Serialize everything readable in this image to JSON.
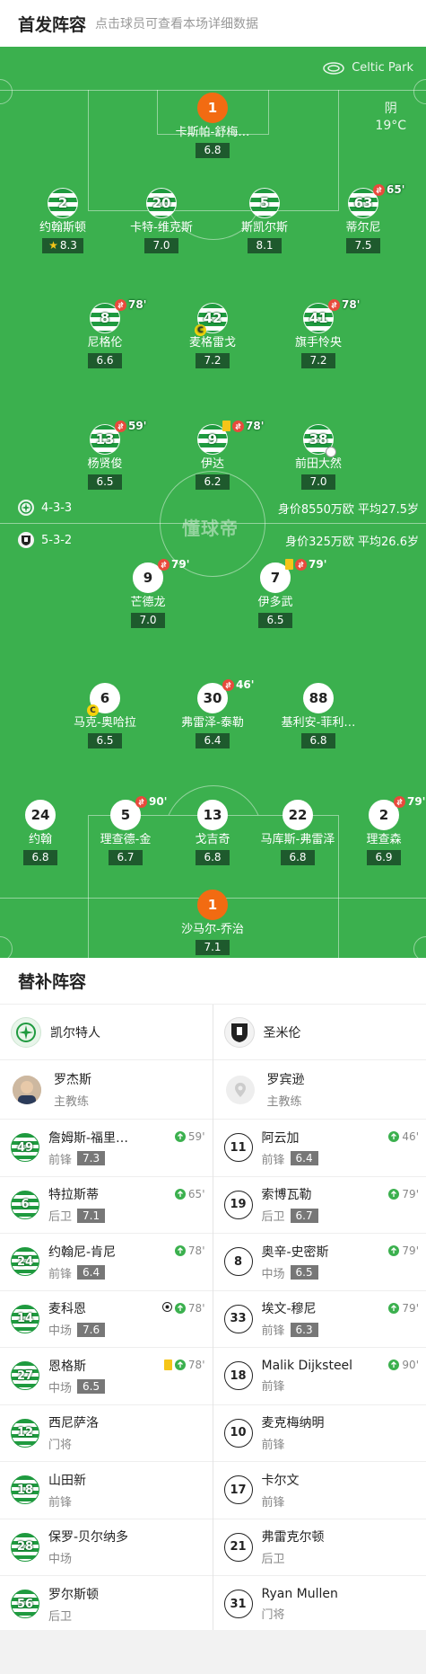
{
  "header": {
    "title": "首发阵容",
    "subtitle": "点击球员可查看本场详细数据"
  },
  "pitch": {
    "venue": "Celtic Park",
    "weather": {
      "condition": "阴",
      "temp": "19°C"
    },
    "watermark": "懂球帝",
    "home": {
      "formation": "4-3-3",
      "info": "身价8550万欧  平均27.5岁"
    },
    "away": {
      "formation": "5-3-2",
      "info": "身价325万欧  平均26.6岁"
    }
  },
  "players": [
    {
      "num": "1",
      "name": "卡斯帕-舒梅…",
      "rating": "6.8",
      "kit": "gk"
    },
    {
      "num": "2",
      "name": "约翰斯顿",
      "rating": "8.3",
      "kit": "hoop",
      "star": true
    },
    {
      "num": "20",
      "name": "卡特-维克斯",
      "rating": "7.0",
      "kit": "hoop"
    },
    {
      "num": "5",
      "name": "斯凯尔斯",
      "rating": "8.1",
      "kit": "hoop"
    },
    {
      "num": "63",
      "name": "蒂尔尼",
      "rating": "7.5",
      "kit": "hoop",
      "sub_out": "65'"
    },
    {
      "num": "8",
      "name": "尼格伦",
      "rating": "6.6",
      "kit": "hoop",
      "sub_out": "78'"
    },
    {
      "num": "42",
      "name": "麦格雷戈",
      "rating": "7.2",
      "kit": "hoop",
      "captain": "C"
    },
    {
      "num": "41",
      "name": "旗手怜央",
      "rating": "7.2",
      "kit": "hoop",
      "sub_out": "78'"
    },
    {
      "num": "13",
      "name": "杨贤俊",
      "rating": "6.5",
      "kit": "hoop",
      "sub_out": "59'"
    },
    {
      "num": "9",
      "name": "伊达",
      "rating": "6.2",
      "kit": "hoop",
      "sub_out": "78'",
      "yellow": true
    },
    {
      "num": "38",
      "name": "前田大然",
      "rating": "7.0",
      "kit": "hoop",
      "goal": true
    },
    {
      "num": "9",
      "name": "芒德龙",
      "rating": "7.0",
      "kit": "white",
      "sub_out": "79'"
    },
    {
      "num": "7",
      "name": "伊多武",
      "rating": "6.5",
      "kit": "white",
      "sub_out": "79'",
      "yellow": true
    },
    {
      "num": "6",
      "name": "马克-奥哈拉",
      "rating": "6.5",
      "kit": "white",
      "captain": "C"
    },
    {
      "num": "30",
      "name": "弗雷泽-泰勒",
      "rating": "6.4",
      "kit": "white",
      "sub_out": "46'"
    },
    {
      "num": "88",
      "name": "基利安-菲利…",
      "rating": "6.8",
      "kit": "white"
    },
    {
      "num": "24",
      "name": "约翰",
      "rating": "6.8",
      "kit": "white"
    },
    {
      "num": "5",
      "name": "理查德-金",
      "rating": "6.7",
      "kit": "white",
      "sub_out": "90'"
    },
    {
      "num": "13",
      "name": "戈吉奇",
      "rating": "6.8",
      "kit": "white"
    },
    {
      "num": "22",
      "name": "马库斯-弗雷泽",
      "rating": "6.8",
      "kit": "white"
    },
    {
      "num": "2",
      "name": "理查森",
      "rating": "6.9",
      "kit": "white",
      "sub_out": "79'"
    },
    {
      "num": "1",
      "name": "沙马尔-乔治",
      "rating": "7.1",
      "kit": "gk"
    }
  ],
  "subs": {
    "title": "替补阵容",
    "home": {
      "team": "凯尔特人",
      "coach": {
        "name": "罗杰斯",
        "role": "主教练"
      },
      "list": [
        {
          "num": "49",
          "name": "詹姆斯-福里…",
          "pos": "前锋",
          "rating": "7.3",
          "time": "59'"
        },
        {
          "num": "6",
          "name": "特拉斯蒂",
          "pos": "后卫",
          "rating": "7.1",
          "time": "65'"
        },
        {
          "num": "24",
          "name": "约翰尼-肯尼",
          "pos": "前锋",
          "rating": "6.4",
          "time": "78'"
        },
        {
          "num": "14",
          "name": "麦科恩",
          "pos": "中场",
          "rating": "7.6",
          "time": "78'",
          "goal": true
        },
        {
          "num": "27",
          "name": "恩格斯",
          "pos": "中场",
          "rating": "6.5",
          "time": "78'",
          "yellow": true
        },
        {
          "num": "12",
          "name": "西尼萨洛",
          "pos": "门将"
        },
        {
          "num": "18",
          "name": "山田新",
          "pos": "前锋"
        },
        {
          "num": "28",
          "name": "保罗-贝尔纳多",
          "pos": "中场"
        },
        {
          "num": "56",
          "name": "罗尔斯顿",
          "pos": "后卫"
        }
      ]
    },
    "away": {
      "team": "圣米伦",
      "coach": {
        "name": "罗宾逊",
        "role": "主教练"
      },
      "list": [
        {
          "num": "11",
          "name": "阿云加",
          "pos": "前锋",
          "rating": "6.4",
          "time": "46'"
        },
        {
          "num": "19",
          "name": "索博瓦勒",
          "pos": "后卫",
          "rating": "6.7",
          "time": "79'"
        },
        {
          "num": "8",
          "name": "奥辛-史密斯",
          "pos": "中场",
          "rating": "6.5",
          "time": "79'"
        },
        {
          "num": "33",
          "name": "埃文-穆尼",
          "pos": "前锋",
          "rating": "6.3",
          "time": "79'"
        },
        {
          "num": "18",
          "name": "Malik Dijksteel",
          "pos": "前锋",
          "time": "90'"
        },
        {
          "num": "10",
          "name": "麦克梅纳明",
          "pos": "前锋"
        },
        {
          "num": "17",
          "name": "卡尔文",
          "pos": "前锋"
        },
        {
          "num": "21",
          "name": "弗雷克尔顿",
          "pos": "后卫"
        },
        {
          "num": "31",
          "name": "Ryan Mullen",
          "pos": "门将"
        }
      ]
    }
  }
}
